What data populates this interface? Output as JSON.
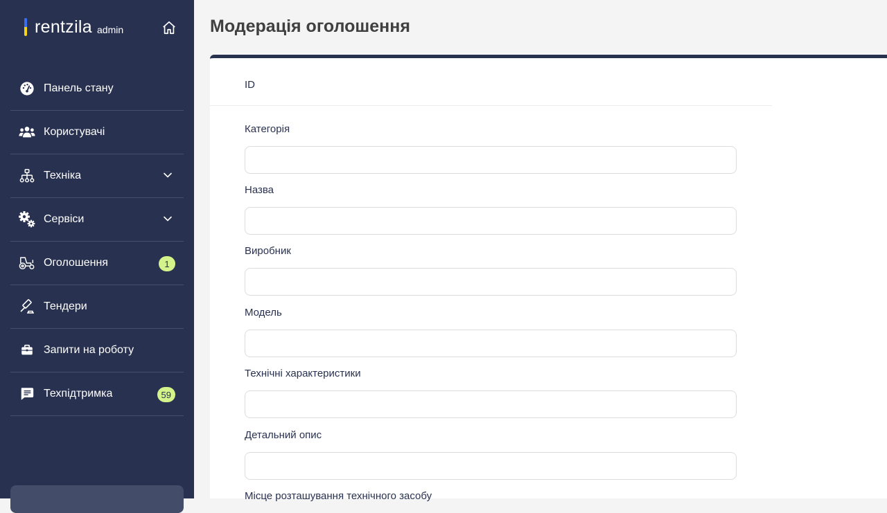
{
  "brand": {
    "name": "rentzila",
    "sub": "admin"
  },
  "sidebar": {
    "items": [
      {
        "label": "Панель стану",
        "icon": "dashboard-gauge-icon"
      },
      {
        "label": "Користувачі",
        "icon": "users-icon"
      },
      {
        "label": "Техніка",
        "icon": "hierarchy-icon",
        "expandable": true
      },
      {
        "label": "Сервіси",
        "icon": "gears-icon",
        "expandable": true
      },
      {
        "label": "Оголошення",
        "icon": "tractor-icon",
        "badge": "1"
      },
      {
        "label": "Тендери",
        "icon": "gavel-icon"
      },
      {
        "label": "Запити на роботу",
        "icon": "briefcase-icon"
      },
      {
        "label": "Техпідтримка",
        "icon": "chat-icon",
        "badge": "59"
      }
    ]
  },
  "colors": {
    "sidebar_bg": "#283150",
    "badge_bg": "#d4f38a",
    "page_bg": "#f4f4f4"
  },
  "main": {
    "title": "Модерація оголошення",
    "id_label": "ID",
    "fields": [
      {
        "label": "Категорія",
        "value": ""
      },
      {
        "label": "Назва",
        "value": ""
      },
      {
        "label": "Виробник",
        "value": ""
      },
      {
        "label": "Модель",
        "value": ""
      },
      {
        "label": "Технічні характеристики",
        "value": ""
      },
      {
        "label": "Детальний опис",
        "value": ""
      },
      {
        "label": "Місце розташування технічного засобу",
        "value": ""
      }
    ]
  }
}
